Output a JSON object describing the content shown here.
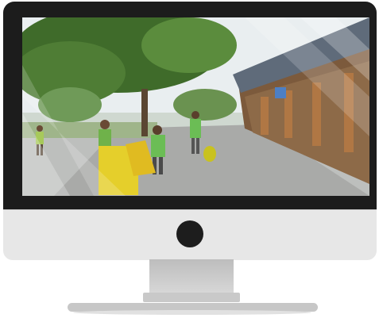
{
  "device": {
    "type": "desktop-monitor",
    "bezel_color": "#1c1c1c",
    "chin_color": "#e7e7e7",
    "stand_color": "#c7c7c7"
  },
  "screen_content": {
    "kind": "photo",
    "icons": [
      "camera-icon"
    ]
  }
}
